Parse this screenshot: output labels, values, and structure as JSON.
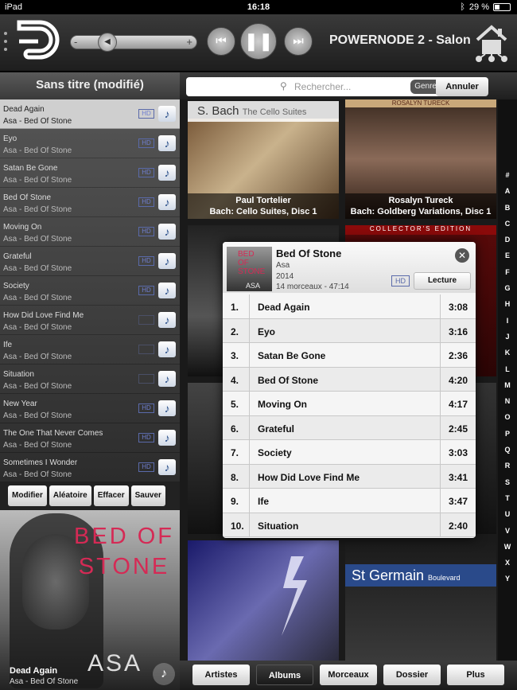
{
  "status": {
    "device": "iPad",
    "time": "16:18",
    "battery": "29 %"
  },
  "header": {
    "zone": "POWERNODE 2 - Salon",
    "volume_minus": "-",
    "volume_plus": "+"
  },
  "playlist": {
    "title": "Sans titre (modifié)",
    "hd_label": "HD",
    "items": [
      {
        "title": "Dead Again",
        "sub": "Asa - Bed Of Stone",
        "selected": true
      },
      {
        "title": "Eyo",
        "sub": "Asa - Bed Of Stone"
      },
      {
        "title": "Satan Be Gone",
        "sub": "Asa - Bed Of Stone"
      },
      {
        "title": "Bed Of Stone",
        "sub": "Asa - Bed Of Stone"
      },
      {
        "title": "Moving On",
        "sub": "Asa - Bed Of Stone"
      },
      {
        "title": "Grateful",
        "sub": "Asa - Bed Of Stone"
      },
      {
        "title": "Society",
        "sub": "Asa - Bed Of Stone"
      },
      {
        "title": "How Did Love Find Me",
        "sub": "Asa - Bed Of Stone"
      },
      {
        "title": "Ife",
        "sub": "Asa - Bed Of Stone"
      },
      {
        "title": "Situation",
        "sub": "Asa - Bed Of Stone"
      },
      {
        "title": "New Year",
        "sub": "Asa - Bed Of Stone"
      },
      {
        "title": "The One That Never Comes",
        "sub": "Asa - Bed Of Stone"
      },
      {
        "title": "Sometimes I Wonder",
        "sub": "Asa - Bed Of Stone"
      }
    ],
    "actions": [
      "Modifier",
      "Aléatoire",
      "Effacer",
      "Sauver"
    ]
  },
  "now_playing": {
    "title": "Dead Again",
    "subtitle": "Asa - Bed Of Stone",
    "art_text": "BED OF STONE",
    "art_artist": "ASA"
  },
  "search": {
    "placeholder": "Rechercher...",
    "genre": "Genre",
    "cancel": "Annuler"
  },
  "library": {
    "banner": "S. Bach",
    "banner_sub": "The Cello Suites",
    "tiles": [
      {
        "line1": "Paul Tortelier",
        "line2": "Bach: Cello Suites, Disc 1"
      },
      {
        "line1": "Rosalyn Tureck",
        "line2": "Bach: Goldberg Variations, Disc 1"
      }
    ],
    "top_right_label": "ROSALYN TURECK",
    "collector_label": "COLLECTOR'S EDITION",
    "stgermain": "St Germain",
    "stgermain_sub": "Boulevard"
  },
  "alphabet": [
    "#",
    "A",
    "B",
    "C",
    "D",
    "E",
    "F",
    "G",
    "H",
    "I",
    "J",
    "K",
    "L",
    "M",
    "N",
    "O",
    "P",
    "Q",
    "R",
    "S",
    "T",
    "U",
    "V",
    "W",
    "X",
    "Y"
  ],
  "album_popup": {
    "title": "Bed Of Stone",
    "artist": "Asa",
    "year": "2014",
    "info": "14 morceaux - 47:14",
    "hd": "HD",
    "play": "Lecture",
    "tracks": [
      {
        "n": "1.",
        "title": "Dead Again",
        "dur": "3:08"
      },
      {
        "n": "2.",
        "title": "Eyo",
        "dur": "3:16"
      },
      {
        "n": "3.",
        "title": "Satan Be Gone",
        "dur": "2:36"
      },
      {
        "n": "4.",
        "title": "Bed Of Stone",
        "dur": "4:20"
      },
      {
        "n": "5.",
        "title": "Moving On",
        "dur": "4:17"
      },
      {
        "n": "6.",
        "title": "Grateful",
        "dur": "2:45"
      },
      {
        "n": "7.",
        "title": "Society",
        "dur": "3:03"
      },
      {
        "n": "8.",
        "title": "How Did Love Find Me",
        "dur": "3:41"
      },
      {
        "n": "9.",
        "title": "Ife",
        "dur": "3:47"
      },
      {
        "n": "10.",
        "title": "Situation",
        "dur": "2:40"
      }
    ]
  },
  "tabs": [
    {
      "label": "Artistes"
    },
    {
      "label": "Albums",
      "active": true
    },
    {
      "label": "Morceaux"
    },
    {
      "label": "Dossier"
    },
    {
      "label": "Plus"
    }
  ]
}
